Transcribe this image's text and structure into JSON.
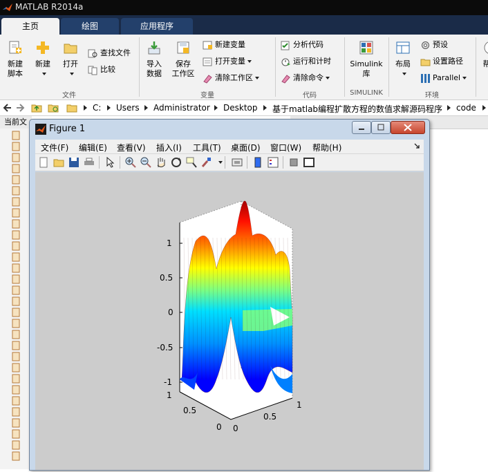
{
  "app": {
    "title": "MATLAB R2014a"
  },
  "tabs": [
    {
      "label": "主页",
      "active": true
    },
    {
      "label": "绘图",
      "active": false
    },
    {
      "label": "应用程序",
      "active": false
    }
  ],
  "ribbon": {
    "file_group": {
      "label": "文件",
      "new_script": "新建\n脚本",
      "new": "新建",
      "open": "打开",
      "find_files": "查找文件",
      "compare": "比较"
    },
    "variable_group": {
      "label": "变量",
      "import": "导入\n数据",
      "save_ws": "保存\n工作区",
      "new_var": "新建变量",
      "open_var": "打开变量",
      "clear_ws": "清除工作区"
    },
    "code_group": {
      "label": "代码",
      "analyze": "分析代码",
      "run_time": "运行和计时",
      "clear_cmd": "清除命令"
    },
    "simulink_group": {
      "label": "SIMULINK",
      "simulink": "Simulink\n库"
    },
    "env_group": {
      "label": "环境",
      "layout": "布局",
      "prefs": "预设",
      "set_path": "设置路径",
      "parallel": "Parallel"
    },
    "help_partial": "帮"
  },
  "address": {
    "crumbs": [
      "C:",
      "Users",
      "Administrator",
      "Desktop",
      "基于matlab编程扩散方程的数值求解源码程序",
      "code"
    ]
  },
  "current_folder_label": "当前文",
  "figure": {
    "title": "Figure 1",
    "menus": [
      "文件(F)",
      "编辑(E)",
      "查看(V)",
      "插入(I)",
      "工具(T)",
      "桌面(D)",
      "窗口(W)",
      "帮助(H)"
    ],
    "plot": {
      "z_ticks": [
        "1",
        "0.5",
        "0",
        "-0.5",
        "-1"
      ],
      "y_ticks": [
        "1",
        "0.5",
        "0"
      ],
      "x_ticks": [
        "0",
        "0.5",
        "1"
      ]
    }
  },
  "colors": {
    "titlebar": "#0b0b0b",
    "tabstrip": "#1a2b48",
    "ribbon_bg": "#f2f2f2",
    "plot_bg": "#cccccc"
  }
}
